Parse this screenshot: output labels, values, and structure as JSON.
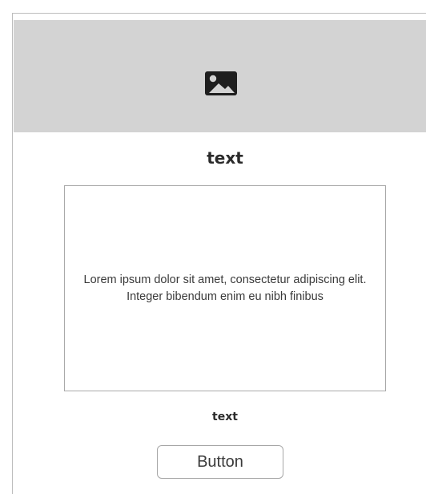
{
  "card": {
    "image_icon": "image-icon",
    "title": "text",
    "body_text": "Lorem ipsum dolor sit amet, consectetur adipiscing elit. Integer bibendum enim eu nibh finibus",
    "subtitle": "text",
    "button_label": "Button"
  },
  "colors": {
    "hero_background": "#d3d3d3",
    "border": "#a9a9a9",
    "text": "#2b2b2b"
  }
}
